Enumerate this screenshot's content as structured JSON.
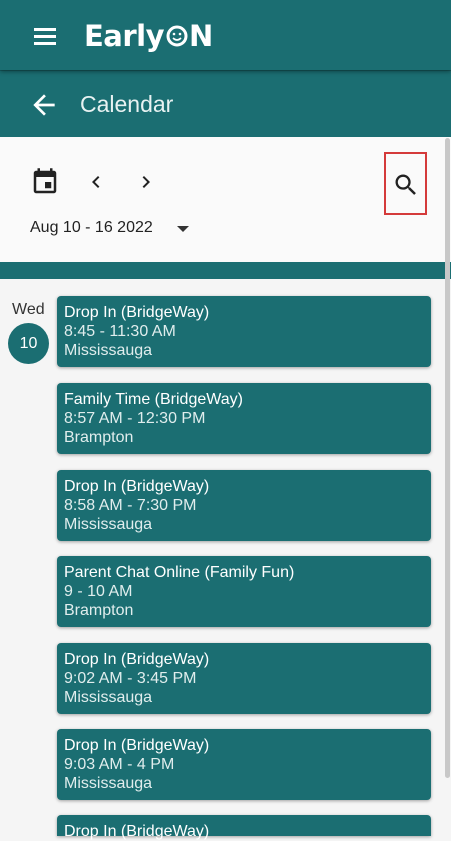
{
  "app": {
    "logo_text_left": "Early",
    "logo_text_right": "N",
    "logo_icon": "smiley-o-icon",
    "menu_icon": "menu-icon"
  },
  "header": {
    "title": "Calendar",
    "back_icon": "arrow-back-icon"
  },
  "toolbar": {
    "calendar_icon": "calendar-icon",
    "prev_icon": "chevron-left-icon",
    "next_icon": "chevron-right-icon",
    "search_icon": "search-icon",
    "date_range": "Aug 10 - 16 2022",
    "dropdown_icon": "caret-down-icon"
  },
  "day": {
    "weekday": "Wed",
    "date": "10"
  },
  "events": [
    {
      "title": "Drop In (BridgeWay)",
      "time": "8:45 - 11:30 AM",
      "location": "Mississauga"
    },
    {
      "title": "Family Time (BridgeWay)",
      "time": "8:57 AM - 12:30 PM",
      "location": "Brampton"
    },
    {
      "title": "Drop In (BridgeWay)",
      "time": "8:58 AM - 7:30 PM",
      "location": "Mississauga"
    },
    {
      "title": "Parent Chat Online (Family Fun)",
      "time": "9 - 10 AM",
      "location": "Brampton"
    },
    {
      "title": "Drop In (BridgeWay)",
      "time": "9:02 AM - 3:45 PM",
      "location": "Mississauga"
    },
    {
      "title": "Drop In (BridgeWay)",
      "time": "9:03 AM - 4 PM",
      "location": "Mississauga"
    },
    {
      "title": "Drop In (BridgeWay)",
      "time": "",
      "location": ""
    }
  ],
  "colors": {
    "primary": "#1b6e72",
    "highlight_border": "#d43a3a",
    "background": "#f5f5f5"
  }
}
